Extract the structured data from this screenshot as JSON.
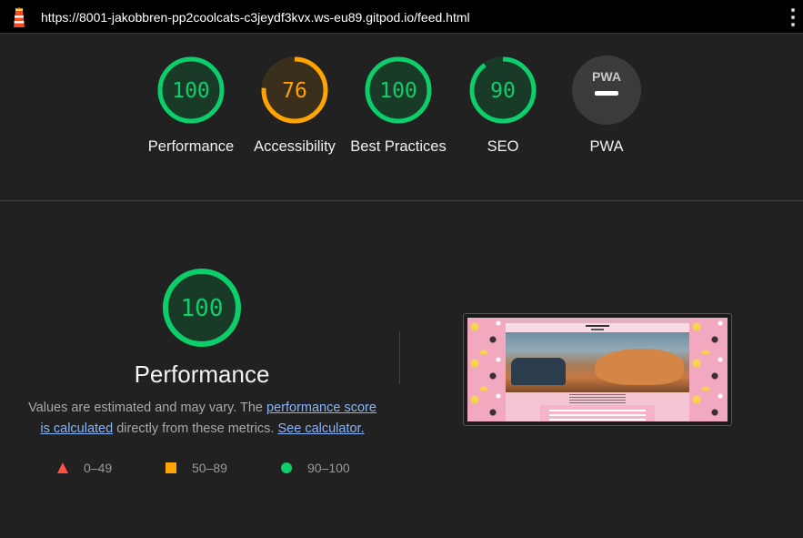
{
  "topbar": {
    "url": "https://8001-jakobbren-pp2coolcats-c3jeydf3kvx.ws-eu89.gitpod.io/feed.html"
  },
  "gauges": [
    {
      "label": "Performance",
      "score": "100",
      "value": 100,
      "color": "#0cce6b"
    },
    {
      "label": "Accessibility",
      "score": "76",
      "value": 76,
      "color": "#ffa400"
    },
    {
      "label": "Best Practices",
      "score": "100",
      "value": 100,
      "color": "#0cce6b"
    },
    {
      "label": "SEO",
      "score": "90",
      "value": 90,
      "color": "#0cce6b"
    },
    {
      "label": "PWA",
      "score": "",
      "value": null,
      "icon": "pwa-badge-icon"
    }
  ],
  "performance": {
    "score": "100",
    "title": "Performance",
    "desc_prefix": "Values are estimated and may vary. The ",
    "score_link": "performance score is calculated",
    "desc_middle": " directly from these metrics. ",
    "calculator_link": "See calculator."
  },
  "legend": [
    {
      "range": "0–49",
      "color": "#ff4e42",
      "icon": "triangle-icon"
    },
    {
      "range": "50–89",
      "color": "#ffa400",
      "icon": "square-icon"
    },
    {
      "range": "90–100",
      "color": "#0cce6b",
      "icon": "circle-icon"
    }
  ],
  "thumbnail": {
    "site_title": "Cool Cat Bulletin"
  },
  "colors": {
    "pass": "#0cce6b",
    "average": "#ffa400",
    "fail": "#ff4e42",
    "link": "#8ab4f8",
    "background": "#212121"
  }
}
